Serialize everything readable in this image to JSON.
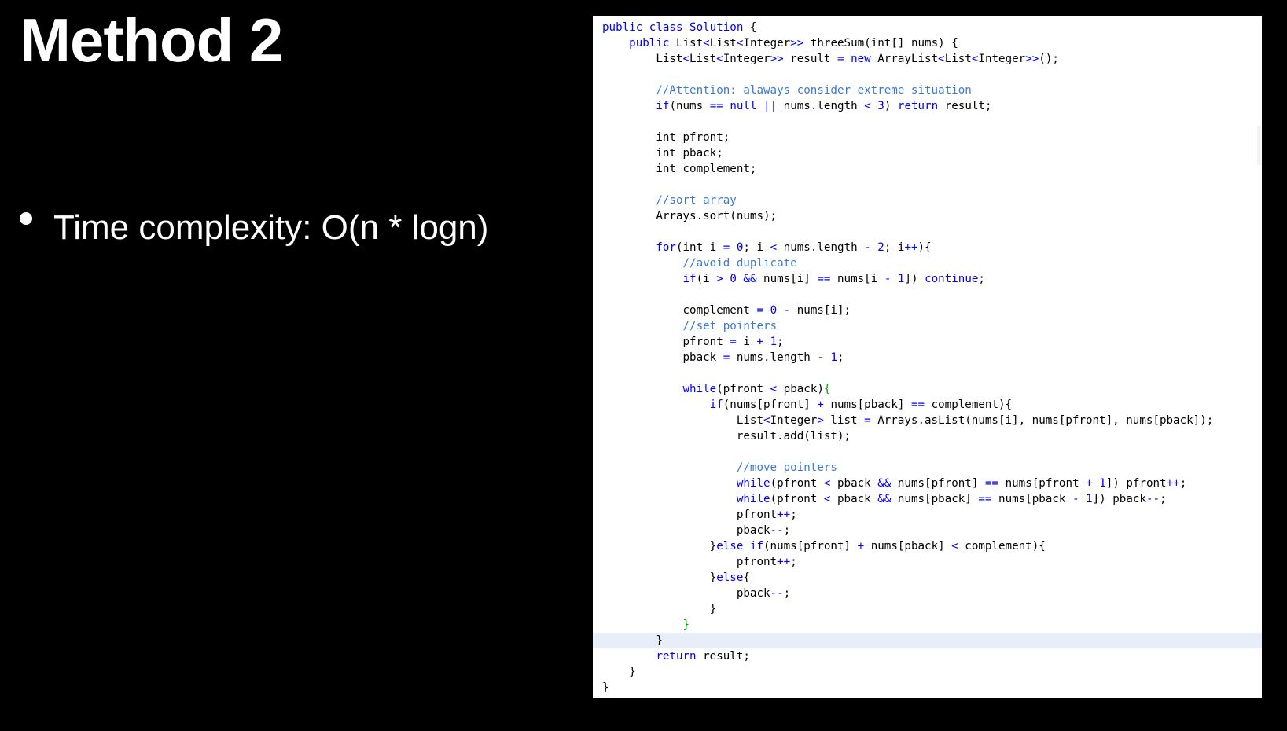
{
  "slide": {
    "title": "Method 2",
    "bullets": [
      "Time complexity: O(n * logn)"
    ]
  },
  "code": {
    "language": "java",
    "colors": {
      "keyword": "#0000ff",
      "comment": "#3c78d8",
      "plain": "#000000",
      "brace_match": "#00a000",
      "current_line": "#e8eef8"
    },
    "highlighted_line": 39,
    "lines": [
      [
        [
          "kw",
          "public class Solution"
        ],
        [
          "pl",
          " {"
        ]
      ],
      [
        [
          "pl",
          "    "
        ],
        [
          "kw",
          "public"
        ],
        [
          "pl",
          " List"
        ],
        [
          "op",
          "<"
        ],
        [
          "pl",
          "List"
        ],
        [
          "op",
          "<"
        ],
        [
          "pl",
          "Integer"
        ],
        [
          "op",
          ">>"
        ],
        [
          "pl",
          " threeSum(int[] nums) {"
        ]
      ],
      [
        [
          "pl",
          "        List"
        ],
        [
          "op",
          "<"
        ],
        [
          "pl",
          "List"
        ],
        [
          "op",
          "<"
        ],
        [
          "pl",
          "Integer"
        ],
        [
          "op",
          ">>"
        ],
        [
          "pl",
          " result "
        ],
        [
          "op",
          "="
        ],
        [
          "pl",
          " "
        ],
        [
          "kw",
          "new"
        ],
        [
          "pl",
          " ArrayList"
        ],
        [
          "op",
          "<"
        ],
        [
          "pl",
          "List"
        ],
        [
          "op",
          "<"
        ],
        [
          "pl",
          "Integer"
        ],
        [
          "op",
          ">>"
        ],
        [
          "pl",
          "();"
        ]
      ],
      [],
      [
        [
          "pl",
          "        "
        ],
        [
          "cm",
          "//Attention: alaways consider extreme situation"
        ]
      ],
      [
        [
          "pl",
          "        "
        ],
        [
          "kw",
          "if"
        ],
        [
          "pl",
          "(nums "
        ],
        [
          "op",
          "=="
        ],
        [
          "pl",
          " "
        ],
        [
          "kw",
          "null"
        ],
        [
          "pl",
          " "
        ],
        [
          "op",
          "||"
        ],
        [
          "pl",
          " nums.length "
        ],
        [
          "op",
          "<"
        ],
        [
          "pl",
          " "
        ],
        [
          "kw",
          "3"
        ],
        [
          "pl",
          ") "
        ],
        [
          "kw",
          "return"
        ],
        [
          "pl",
          " result;"
        ]
      ],
      [],
      [
        [
          "pl",
          "        int pfront;"
        ]
      ],
      [
        [
          "pl",
          "        int pback;"
        ]
      ],
      [
        [
          "pl",
          "        int complement;"
        ]
      ],
      [],
      [
        [
          "pl",
          "        "
        ],
        [
          "cm",
          "//sort array"
        ]
      ],
      [
        [
          "pl",
          "        Arrays.sort(nums);"
        ]
      ],
      [],
      [
        [
          "pl",
          "        "
        ],
        [
          "kw",
          "for"
        ],
        [
          "pl",
          "(int i "
        ],
        [
          "op",
          "="
        ],
        [
          "pl",
          " "
        ],
        [
          "kw",
          "0"
        ],
        [
          "pl",
          "; i "
        ],
        [
          "op",
          "<"
        ],
        [
          "pl",
          " nums.length "
        ],
        [
          "op",
          "-"
        ],
        [
          "pl",
          " "
        ],
        [
          "kw",
          "2"
        ],
        [
          "pl",
          "; i"
        ],
        [
          "op",
          "++"
        ],
        [
          "pl",
          "){"
        ]
      ],
      [
        [
          "pl",
          "            "
        ],
        [
          "cm",
          "//avoid duplicate"
        ]
      ],
      [
        [
          "pl",
          "            "
        ],
        [
          "kw",
          "if"
        ],
        [
          "pl",
          "(i "
        ],
        [
          "op",
          ">"
        ],
        [
          "pl",
          " "
        ],
        [
          "kw",
          "0"
        ],
        [
          "pl",
          " "
        ],
        [
          "op",
          "&&"
        ],
        [
          "pl",
          " nums[i] "
        ],
        [
          "op",
          "=="
        ],
        [
          "pl",
          " nums[i "
        ],
        [
          "op",
          "-"
        ],
        [
          "pl",
          " "
        ],
        [
          "kw",
          "1"
        ],
        [
          "pl",
          "]) "
        ],
        [
          "kw",
          "continue"
        ],
        [
          "pl",
          ";"
        ]
      ],
      [],
      [
        [
          "pl",
          "            complement "
        ],
        [
          "op",
          "="
        ],
        [
          "pl",
          " "
        ],
        [
          "kw",
          "0"
        ],
        [
          "pl",
          " "
        ],
        [
          "op",
          "-"
        ],
        [
          "pl",
          " nums[i];"
        ]
      ],
      [
        [
          "pl",
          "            "
        ],
        [
          "cm",
          "//set pointers"
        ]
      ],
      [
        [
          "pl",
          "            pfront "
        ],
        [
          "op",
          "="
        ],
        [
          "pl",
          " i "
        ],
        [
          "op",
          "+"
        ],
        [
          "pl",
          " "
        ],
        [
          "kw",
          "1"
        ],
        [
          "pl",
          ";"
        ]
      ],
      [
        [
          "pl",
          "            pback "
        ],
        [
          "op",
          "="
        ],
        [
          "pl",
          " nums.length "
        ],
        [
          "op",
          "-"
        ],
        [
          "pl",
          " "
        ],
        [
          "kw",
          "1"
        ],
        [
          "pl",
          ";"
        ]
      ],
      [],
      [
        [
          "pl",
          "            "
        ],
        [
          "kw",
          "while"
        ],
        [
          "pl",
          "(pfront "
        ],
        [
          "op",
          "<"
        ],
        [
          "pl",
          " pback)"
        ],
        [
          "gb",
          "{"
        ]
      ],
      [
        [
          "pl",
          "                "
        ],
        [
          "kw",
          "if"
        ],
        [
          "pl",
          "(nums[pfront] "
        ],
        [
          "op",
          "+"
        ],
        [
          "pl",
          " nums[pback] "
        ],
        [
          "op",
          "=="
        ],
        [
          "pl",
          " complement){"
        ]
      ],
      [
        [
          "pl",
          "                    List"
        ],
        [
          "op",
          "<"
        ],
        [
          "pl",
          "Integer"
        ],
        [
          "op",
          ">"
        ],
        [
          "pl",
          " list "
        ],
        [
          "op",
          "="
        ],
        [
          "pl",
          " Arrays.asList(nums[i], nums[pfront], nums[pback]);"
        ]
      ],
      [
        [
          "pl",
          "                    result.add(list);"
        ]
      ],
      [],
      [
        [
          "pl",
          "                    "
        ],
        [
          "cm",
          "//move pointers"
        ]
      ],
      [
        [
          "pl",
          "                    "
        ],
        [
          "kw",
          "while"
        ],
        [
          "pl",
          "(pfront "
        ],
        [
          "op",
          "<"
        ],
        [
          "pl",
          " pback "
        ],
        [
          "op",
          "&&"
        ],
        [
          "pl",
          " nums[pfront] "
        ],
        [
          "op",
          "=="
        ],
        [
          "pl",
          " nums[pfront "
        ],
        [
          "op",
          "+"
        ],
        [
          "pl",
          " "
        ],
        [
          "kw",
          "1"
        ],
        [
          "pl",
          "]) pfront"
        ],
        [
          "op",
          "++"
        ],
        [
          "pl",
          ";"
        ]
      ],
      [
        [
          "pl",
          "                    "
        ],
        [
          "kw",
          "while"
        ],
        [
          "pl",
          "(pfront "
        ],
        [
          "op",
          "<"
        ],
        [
          "pl",
          " pback "
        ],
        [
          "op",
          "&&"
        ],
        [
          "pl",
          " nums[pback] "
        ],
        [
          "op",
          "=="
        ],
        [
          "pl",
          " nums[pback "
        ],
        [
          "op",
          "-"
        ],
        [
          "pl",
          " "
        ],
        [
          "kw",
          "1"
        ],
        [
          "pl",
          "]) pback"
        ],
        [
          "op",
          "--"
        ],
        [
          "pl",
          ";"
        ]
      ],
      [
        [
          "pl",
          "                    pfront"
        ],
        [
          "op",
          "++"
        ],
        [
          "pl",
          ";"
        ]
      ],
      [
        [
          "pl",
          "                    pback"
        ],
        [
          "op",
          "--"
        ],
        [
          "pl",
          ";"
        ]
      ],
      [
        [
          "pl",
          "                }"
        ],
        [
          "kw",
          "else if"
        ],
        [
          "pl",
          "(nums[pfront] "
        ],
        [
          "op",
          "+"
        ],
        [
          "pl",
          " nums[pback] "
        ],
        [
          "op",
          "<"
        ],
        [
          "pl",
          " complement){"
        ]
      ],
      [
        [
          "pl",
          "                    pfront"
        ],
        [
          "op",
          "++"
        ],
        [
          "pl",
          ";"
        ]
      ],
      [
        [
          "pl",
          "                }"
        ],
        [
          "kw",
          "else"
        ],
        [
          "pl",
          "{"
        ]
      ],
      [
        [
          "pl",
          "                    pback"
        ],
        [
          "op",
          "--"
        ],
        [
          "pl",
          ";"
        ]
      ],
      [
        [
          "pl",
          "                }"
        ]
      ],
      [
        [
          "pl",
          "            "
        ],
        [
          "gb",
          "}"
        ]
      ],
      [
        [
          "pl",
          "        }"
        ]
      ],
      [
        [
          "pl",
          "        "
        ],
        [
          "kw",
          "return"
        ],
        [
          "pl",
          " result;"
        ]
      ],
      [
        [
          "pl",
          "    }"
        ]
      ],
      [
        [
          "pl",
          "}"
        ]
      ]
    ]
  }
}
